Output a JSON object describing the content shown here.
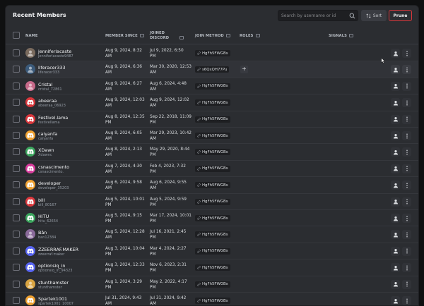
{
  "header": {
    "title": "Recent Members"
  },
  "search": {
    "placeholder": "Search by username or id"
  },
  "toolbar": {
    "sort_label": "Sort",
    "prune_label": "Prune"
  },
  "columns": {
    "name": "NAME",
    "member_since": "MEMBER SINCE",
    "joined_discord_1": "JOINED",
    "joined_discord_2": "DISCORD",
    "join_method": "JOIN METHOD",
    "roles": "ROLES",
    "signals": "SIGNALS"
  },
  "colors": {
    "danger": "#da373c",
    "bg": "#2b2d31",
    "row_highlight": "#313338"
  },
  "members": [
    {
      "name": "jenniferlacaste",
      "handle": "jenniferlacaste9487",
      "member_since_1": "Aug 9, 2024, 8:32",
      "member_since_2": "AM",
      "joined_1": "Jul 9, 2022, 6:50",
      "joined_2": "PM",
      "join_method": "HgFh5FWGBs",
      "avatar_color": "#7a6b5e",
      "avatar_type": "photo"
    },
    {
      "name": "liferacer333",
      "handle": "liferacer333",
      "member_since_1": "Aug 9, 2024, 6:36",
      "member_since_2": "AM",
      "joined_1": "Mar 30, 2020, 12:53",
      "joined_2": "AM",
      "join_method": "s6QxQH77Pu",
      "avatar_color": "#3b5a7a",
      "avatar_type": "photo"
    },
    {
      "name": "Cristal",
      "handle": "cristal_72861",
      "member_since_1": "Aug 9, 2024, 6:27",
      "member_since_2": "AM",
      "joined_1": "Aug 6, 2024, 4:48",
      "joined_2": "AM",
      "join_method": "HgFh5FWGBs",
      "avatar_color": "#c76a8a",
      "avatar_type": "photo"
    },
    {
      "name": "abeeraa",
      "handle": "abeeraa_06923",
      "member_since_1": "Aug 9, 2024, 12:03",
      "member_since_2": "AM",
      "joined_1": "Aug 9, 2024, 12:02",
      "joined_2": "AM",
      "join_method": "HgFh5FWGBs",
      "avatar_color": "#da373c",
      "avatar_type": "discord"
    },
    {
      "name": "Festivel.lama",
      "handle": "festivellama",
      "member_since_1": "Aug 8, 2024, 12:35",
      "member_since_2": "PM",
      "joined_1": "Sep 22, 2018, 11:09",
      "joined_2": "PM",
      "join_method": "HgFh5FWGBs",
      "avatar_color": "#da373c",
      "avatar_type": "discord"
    },
    {
      "name": "caiyanfa",
      "handle": "caiyanfa",
      "member_since_1": "Aug 8, 2024, 6:05",
      "member_since_2": "AM",
      "joined_1": "Mar 29, 2023, 10:42",
      "joined_2": "AM",
      "join_method": "HgFh5FWGBs",
      "avatar_color": "#f0a232",
      "avatar_type": "discord"
    },
    {
      "name": "XDawn",
      "handle": "Xdawnc",
      "member_since_1": "Aug 8, 2024, 2:13",
      "member_since_2": "AM",
      "joined_1": "May 29, 2020, 8:44",
      "joined_2": "PM",
      "join_method": "HgFh5FWGBs",
      "avatar_color": "#3ba55d",
      "avatar_type": "discord"
    },
    {
      "name": "csnascimento",
      "handle": "csnascimento.",
      "member_since_1": "Aug 7, 2024, 4:30",
      "member_since_2": "AM",
      "joined_1": "Feb 4, 2023, 7:32",
      "joined_2": "PM",
      "join_method": "HgFh5FWGBs",
      "avatar_color": "#d83c9c",
      "avatar_type": "discord"
    },
    {
      "name": "developer",
      "handle": "developer_35203",
      "member_since_1": "Aug 6, 2024, 9:58",
      "member_since_2": "AM",
      "joined_1": "Aug 6, 2024, 9:55",
      "joined_2": "AM",
      "join_method": "HgFh5FWGBs",
      "avatar_color": "#f0a232",
      "avatar_type": "discord"
    },
    {
      "name": "bill",
      "handle": "bill_80167",
      "member_since_1": "Aug 5, 2024, 10:01",
      "member_since_2": "PM",
      "joined_1": "Aug 5, 2024, 9:59",
      "joined_2": "PM",
      "join_method": "HgFh5FWGBs",
      "avatar_color": "#da373c",
      "avatar_type": "discord"
    },
    {
      "name": "HITU",
      "handle": "hitu_62654",
      "member_since_1": "Aug 5, 2024, 9:15",
      "member_since_2": "PM",
      "joined_1": "Mar 17, 2024, 10:01",
      "joined_2": "PM",
      "join_method": "HgFh5FWGBs",
      "avatar_color": "#3ba55d",
      "avatar_type": "discord"
    },
    {
      "name": "Bân",
      "handle": "ban12384",
      "member_since_1": "Aug 5, 2024, 12:28",
      "member_since_2": "AM",
      "joined_1": "Jul 16, 2021, 2:45",
      "joined_2": "PM",
      "join_method": "HgFh5FWGBs",
      "avatar_color": "#8a6a9a",
      "avatar_type": "photo"
    },
    {
      "name": "ZZEERRAF.MAKER",
      "handle": "zzeerraf.maker",
      "member_since_1": "Aug 3, 2024, 10:04",
      "member_since_2": "PM",
      "joined_1": "Mar 4, 2024, 2:27",
      "joined_2": "PM",
      "join_method": "HgFh5FWGBs",
      "avatar_color": "#5865f2",
      "avatar_type": "discord"
    },
    {
      "name": "optionsiq_in",
      "handle": "optionsiq_in_94323",
      "member_since_1": "Aug 3, 2024, 12:33",
      "member_since_2": "PM",
      "joined_1": "Nov 6, 2023, 2:31",
      "joined_2": "PM",
      "join_method": "HgFh5FWGBs",
      "avatar_color": "#5865f2",
      "avatar_type": "discord"
    },
    {
      "name": "stunthamster",
      "handle": "stunthamster",
      "member_since_1": "Aug 1, 2024, 3:29",
      "member_since_2": "PM",
      "joined_1": "May 2, 2022, 4:17",
      "joined_2": "PM",
      "join_method": "HgFh5FWGBs",
      "avatar_color": "#d9a441",
      "avatar_type": "photo"
    },
    {
      "name": "Spartek1001",
      "handle": "spartek1001_10007",
      "member_since_1": "Jul 31, 2024, 9:43",
      "member_since_2": "AM",
      "joined_1": "Jul 31, 2024, 9:42",
      "joined_2": "AM",
      "join_method": "HgFh5FWGBs",
      "avatar_color": "#f0a232",
      "avatar_type": "discord"
    }
  ],
  "highlighted_row": 1
}
